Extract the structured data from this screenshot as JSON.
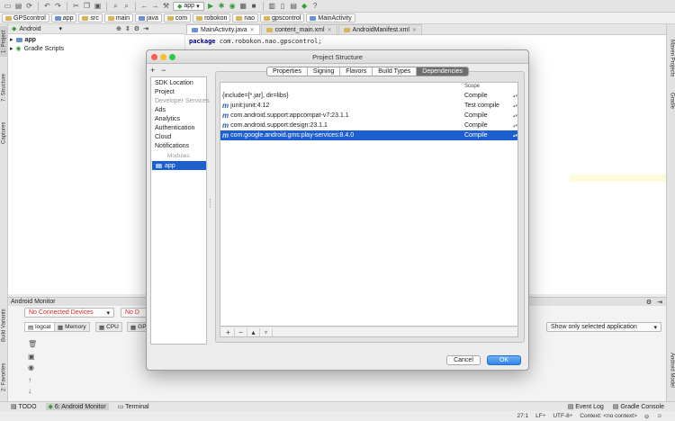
{
  "toolbar": {
    "run_config": "app",
    "icons": [
      "open-icon",
      "save-icon",
      "sync-icon",
      "back-icon",
      "forward-icon",
      "cut-icon",
      "copy-icon",
      "paste-icon",
      "find-icon",
      "replace-icon",
      "back-nav-icon",
      "forward-nav-icon",
      "build-icon",
      "run-icon",
      "debug-icon",
      "attach-icon",
      "stop-icon",
      "sdk-manager-icon",
      "avd-manager-icon",
      "android-device-monitor-icon",
      "help-icon"
    ]
  },
  "breadcrumb": [
    "GPScontrol",
    "app",
    "src",
    "main",
    "java",
    "com",
    "robokon",
    "nao",
    "gpscontrol",
    "MainActivity"
  ],
  "left_strip": {
    "project": "1: Project",
    "structure": "7: Structure",
    "captures": "Captures",
    "build_variants": "Build Variants",
    "favorites": "2: Favorites"
  },
  "right_strip": {
    "maven": "Maven Projects",
    "gradle": "Gradle",
    "android_model": "Android Model"
  },
  "project_panel": {
    "view": "Android",
    "tree": [
      {
        "label": "app",
        "bold": true
      },
      {
        "label": "Gradle Scripts",
        "bold": false
      }
    ]
  },
  "editor": {
    "tabs": [
      {
        "label": "MainActivity.java",
        "active": true
      },
      {
        "label": "content_main.xml",
        "active": false
      },
      {
        "label": "AndroidManifest.xml",
        "active": false
      }
    ],
    "code_keyword": "package",
    "code_rest": " com.robokon.nao.gpscontrol;"
  },
  "monitor": {
    "title": "Android Monitor",
    "device": "No Connected Devices",
    "process_stub": "No D",
    "tabs": [
      "logcat",
      "Memory",
      "CPU",
      "GP"
    ],
    "filter": "Show only selected application"
  },
  "statusbar": {
    "todo": "TODO",
    "android_monitor": "6: Android Monitor",
    "terminal": "Terminal",
    "event_log": "Event Log",
    "gradle_console": "Gradle Console",
    "pos": "27:1",
    "line_sep": "LF÷",
    "encoding": "UTF-8÷",
    "context": "Context: <no context>"
  },
  "dialog": {
    "title": "Project Structure",
    "add_label": "+",
    "remove_label": "−",
    "left_items": [
      "SDK Location",
      "Project",
      "Developer Services",
      "Ads",
      "Analytics",
      "Authentication",
      "Cloud",
      "Notifications"
    ],
    "modules_header": "Modules",
    "module": "app",
    "tabs": [
      {
        "label": "Properties",
        "active": false
      },
      {
        "label": "Signing",
        "active": false
      },
      {
        "label": "Flavors",
        "active": false
      },
      {
        "label": "Build Types",
        "active": false
      },
      {
        "label": "Dependencies",
        "active": true
      }
    ],
    "scope_header": "Scope",
    "dependencies": [
      {
        "icon": "",
        "name": "{include=[*.jar], dir=libs}",
        "scope": "Compile",
        "selected": false
      },
      {
        "icon": "m",
        "name": "junit:junit:4.12",
        "scope": "Test compile",
        "selected": false
      },
      {
        "icon": "m",
        "name": "com.android.support:appcompat-v7:23.1.1",
        "scope": "Compile",
        "selected": false
      },
      {
        "icon": "m",
        "name": "com.android.support:design:23.1.1",
        "scope": "Compile",
        "selected": false
      },
      {
        "icon": "m",
        "name": "com.google.android.gms:play-services:8.4.0",
        "scope": "Compile",
        "selected": true
      }
    ],
    "cancel": "Cancel",
    "ok": "OK"
  },
  "colors": {
    "accent": "#1d5fcf",
    "ok": "#2f86e8",
    "run_green": "#3a9b3a",
    "error_red": "#d32f2f"
  }
}
